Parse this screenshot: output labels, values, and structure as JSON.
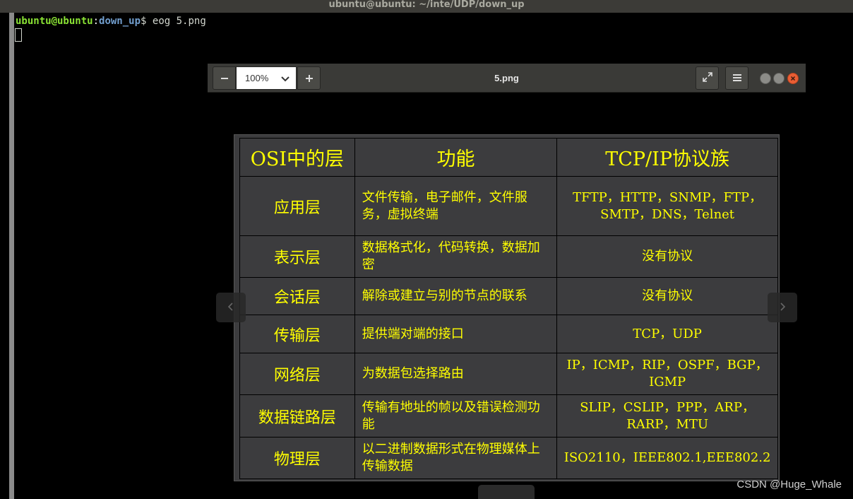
{
  "terminal": {
    "title": "ubuntu@ubuntu: ~/inte/UDP/down_up",
    "prompt_user": "ubuntu@ubuntu",
    "prompt_colon": ":",
    "prompt_path": "down_up",
    "prompt_dollar": "$",
    "command": " eog 5.png"
  },
  "viewer": {
    "title": "5.png",
    "zoom_value": "100%",
    "icons": {
      "zoom_out": "minus-icon",
      "zoom_in": "plus-icon",
      "zoom_dropdown": "chevron-down-icon",
      "fullscreen": "fullscreen-icon",
      "menu": "hamburger-menu-icon",
      "prev": "chevron-left-icon",
      "next": "chevron-right-icon"
    }
  },
  "image_table": {
    "headers": [
      "OSI中的层",
      "功能",
      "TCP/IP协议族"
    ],
    "rows": [
      {
        "layer": "应用层",
        "func": "文件传输，电子邮件，文件服务，虚拟终端",
        "proto": "TFTP，HTTP，SNMP，FTP，SMTP，DNS，Telnet"
      },
      {
        "layer": "表示层",
        "func": "数据格式化，代码转换，数据加密",
        "proto": "没有协议"
      },
      {
        "layer": "会话层",
        "func": "解除或建立与别的节点的联系",
        "proto": "没有协议"
      },
      {
        "layer": "传输层",
        "func": "提供端对端的接口",
        "proto": "TCP，UDP"
      },
      {
        "layer": "网络层",
        "func": "为数据包选择路由",
        "proto": "IP，ICMP，RIP，OSPF，BGP，IGMP"
      },
      {
        "layer": "数据链路层",
        "func": "传输有地址的帧以及错误检测功能",
        "proto": "SLIP，CSLIP，PPP，ARP，RARP，MTU"
      },
      {
        "layer": "物理层",
        "func": "以二进制数据形式在物理媒体上传输数据",
        "proto": "ISO2110，IEEE802.1,EEE802.2"
      }
    ]
  },
  "watermark": "CSDN @Huge_Whale",
  "colors": {
    "table_text": "#ffff00",
    "table_bg": "#3c3c3e",
    "close_button": "#ea5e34",
    "prompt_user": "#8ae234",
    "prompt_path": "#729fcf"
  }
}
